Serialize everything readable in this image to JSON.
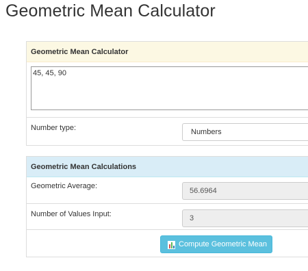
{
  "page": {
    "title": "Geometric Mean Calculator"
  },
  "input_panel": {
    "heading": "Geometric Mean Calculator",
    "numbers_value": "45, 45, 90",
    "number_type_label": "Number type:",
    "number_type_selected": "Numbers"
  },
  "calc_panel": {
    "heading": "Geometric Mean Calculations",
    "geometric_average_label": "Geometric Average:",
    "geometric_average_value": "56.6964",
    "count_label": "Number of Values Input:",
    "count_value": "3",
    "compute_button_label": "Compute Geometric Mean",
    "compute_button_icon": "bar-chart-icon"
  },
  "colors": {
    "input_heading_bg": "#fcf8e3",
    "calc_heading_bg": "#d9edf7",
    "button_bg": "#5bc0de"
  }
}
